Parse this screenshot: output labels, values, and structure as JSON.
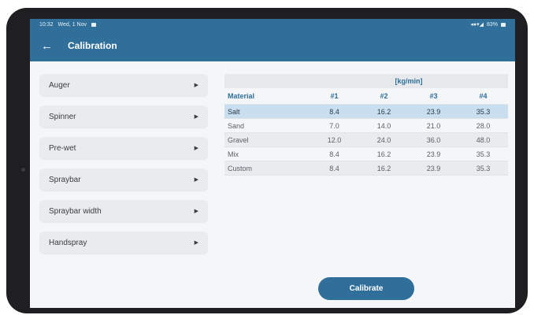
{
  "status_bar": {
    "time": "10:32",
    "date": "Wed, 1 Nov",
    "battery": "83%"
  },
  "app_bar": {
    "title": "Calibration",
    "back_icon": "arrow-left-icon"
  },
  "menu": {
    "items": [
      {
        "label": "Auger"
      },
      {
        "label": "Spinner"
      },
      {
        "label": "Pre-wet"
      },
      {
        "label": "Spraybar"
      },
      {
        "label": "Spraybar width"
      },
      {
        "label": "Handspray"
      }
    ]
  },
  "table": {
    "unit": "[kg/min]",
    "headers": [
      "Material",
      "#1",
      "#2",
      "#3",
      "#4"
    ],
    "rows": [
      {
        "name": "Salt",
        "v1": "8.4",
        "v2": "16.2",
        "v3": "23.9",
        "v4": "35.3"
      },
      {
        "name": "Sand",
        "v1": "7.0",
        "v2": "14.0",
        "v3": "21.0",
        "v4": "28.0"
      },
      {
        "name": "Gravel",
        "v1": "12.0",
        "v2": "24.0",
        "v3": "36.0",
        "v4": "48.0"
      },
      {
        "name": "Mix",
        "v1": "8.4",
        "v2": "16.2",
        "v3": "23.9",
        "v4": "35.3"
      },
      {
        "name": "Custom",
        "v1": "8.4",
        "v2": "16.2",
        "v3": "23.9",
        "v4": "35.3"
      }
    ],
    "selected_row": "Salt"
  },
  "actions": {
    "calibrate_label": "Calibrate"
  },
  "colors": {
    "primary": "#2f6f99",
    "selected_row": "#c9dff0",
    "background": "#f5f6f8"
  }
}
